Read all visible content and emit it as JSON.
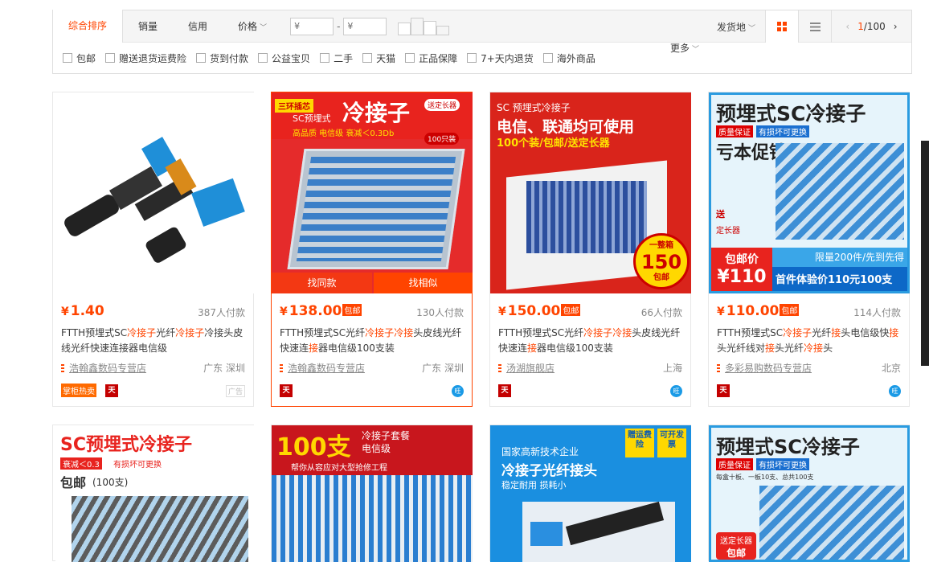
{
  "sort": {
    "items": [
      "综合排序",
      "销量",
      "信用",
      "价格"
    ],
    "price_from": "¥",
    "price_to": "¥",
    "dash": "-",
    "ship_from": "发货地",
    "page_current": "1",
    "page_total": "/100"
  },
  "filters": [
    "包邮",
    "赠送退货运费险",
    "货到付款",
    "公益宝贝",
    "二手",
    "天猫",
    "正品保障",
    "7+天内退货",
    "海外商品"
  ],
  "more": "更多",
  "products": [
    {
      "price": "1.40",
      "deal": "387人付款",
      "title_parts": [
        "FTTH预埋式SC",
        "冷接子",
        "光纤",
        "冷接子",
        "冷接头皮线光纤快速连接器电信级"
      ],
      "shop": "浩翰鑫数码专营店",
      "loc": "广东 深圳",
      "hot": "掌柜热卖",
      "ad": "广告"
    },
    {
      "price": "138.00",
      "badge": "包邮",
      "deal": "130人付款",
      "title_parts": [
        "FTTH预埋式SC光纤",
        "冷接子",
        "冷接",
        "头皮线光纤快速连",
        "接",
        "器电信级100支装"
      ],
      "shop": "浩翰鑫数码专营店",
      "loc": "广东 深圳",
      "ov_a": "找同款",
      "ov_b": "找相似"
    },
    {
      "price": "150.00",
      "badge": "包邮",
      "deal": "66人付款",
      "title_parts": [
        "FTTH预埋式SC光纤",
        "冷接子",
        "冷接",
        "头皮线光纤快速连",
        "接",
        "器电信级100支装"
      ],
      "shop": "汤湖旗舰店",
      "loc": "上海"
    },
    {
      "price": "110.00",
      "badge": "包邮",
      "deal": "114人付款",
      "title_parts": [
        "FTTH预埋式SC",
        "冷接子",
        "光纤",
        "接",
        "头电信级快",
        "接",
        "头光纤线对",
        "接",
        "头光纤",
        "冷接",
        "头"
      ],
      "shop": "多彩易购数码专营店",
      "loc": "北京"
    }
  ],
  "images": {
    "p2": {
      "line1": "三环插芯",
      "line2": "SC预埋式",
      "big": "冷接子",
      "sub": "高品质 电信级 衰减＜0.3Db",
      "tag": "送定长器",
      "tag2": "100只装"
    },
    "p3": {
      "l1": "SC 预埋式冷接子",
      "l2": "电信、联通均可使用",
      "l3": "100个装/包邮/送定长器",
      "bad1": "一整箱",
      "bad2": "150",
      "bad3": "包邮"
    },
    "p4": {
      "l1": "预埋式SC冷接子",
      "l2": "质量保证",
      "l3": "有损坏可更换",
      "l4": "亏本促销",
      "l5": "送",
      "l6": "定长器",
      "l7": "包邮价",
      "l8": "¥110",
      "l9": "限量200件/先到先得",
      "l10": "首件体验价110元100支"
    },
    "r2a": {
      "l1": "SC预埋式冷接子",
      "l2": "衰减＜0.3",
      "l3": "有损坏可更换",
      "l4": "包邮",
      "l5": "(100支)"
    },
    "r2b": {
      "l1": "100支",
      "l2": "冷接子套餐",
      "l3": "电信级",
      "l4": "帮你从容应对大型抢修工程"
    },
    "r2c": {
      "l1": "国家高新技术企业",
      "l2": "冷接子光纤接头",
      "l3": "稳定耐用 损耗小",
      "l4": "赠运费险",
      "l5": "可开发票"
    },
    "r2d": {
      "l1": "预埋式SC冷接子",
      "l2": "质量保证",
      "l3": "有损坏可更换",
      "l4": "每盒十板、一板10支、总共100支",
      "l5": "送定长器",
      "l6": "包邮"
    }
  },
  "tmall_glyph": "天",
  "ww_glyph": "旺"
}
